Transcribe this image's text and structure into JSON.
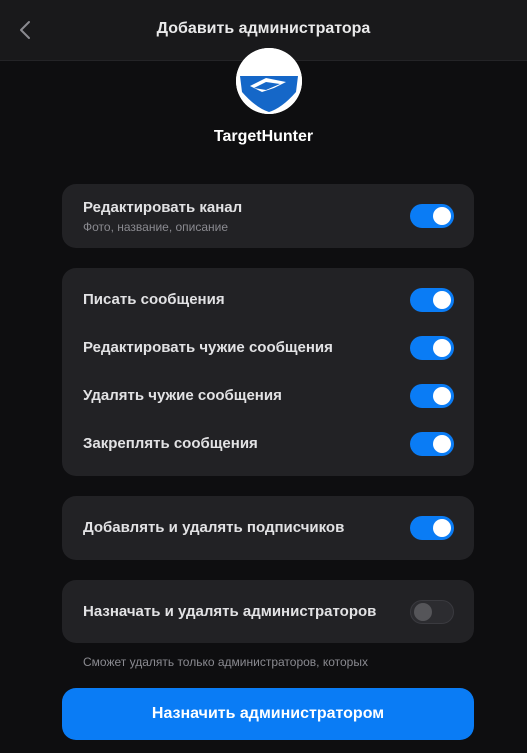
{
  "header": {
    "title": "Добавить администратора"
  },
  "channel": {
    "name": "TargetHunter"
  },
  "group1": {
    "title": "Редактировать канал",
    "subtitle": "Фото, название, описание",
    "enabled": true
  },
  "group2": {
    "items": [
      {
        "label": "Писать сообщения",
        "enabled": true
      },
      {
        "label": "Редактировать чужие сообщения",
        "enabled": true
      },
      {
        "label": "Удалять чужие сообщения",
        "enabled": true
      },
      {
        "label": "Закреплять сообщения",
        "enabled": true
      }
    ]
  },
  "group3": {
    "label": "Добавлять и удалять подписчиков",
    "enabled": true
  },
  "group4": {
    "label": "Назначать и удалять администраторов",
    "enabled": false
  },
  "hint": "Сможет удалять только администраторов, которых",
  "primary_button": "Назначить администратором",
  "colors": {
    "accent": "#0a7cf5",
    "background": "#0e0e10",
    "card": "#222225"
  },
  "icons": {
    "back": "chevron-left-icon",
    "avatar": "channel-logo"
  }
}
